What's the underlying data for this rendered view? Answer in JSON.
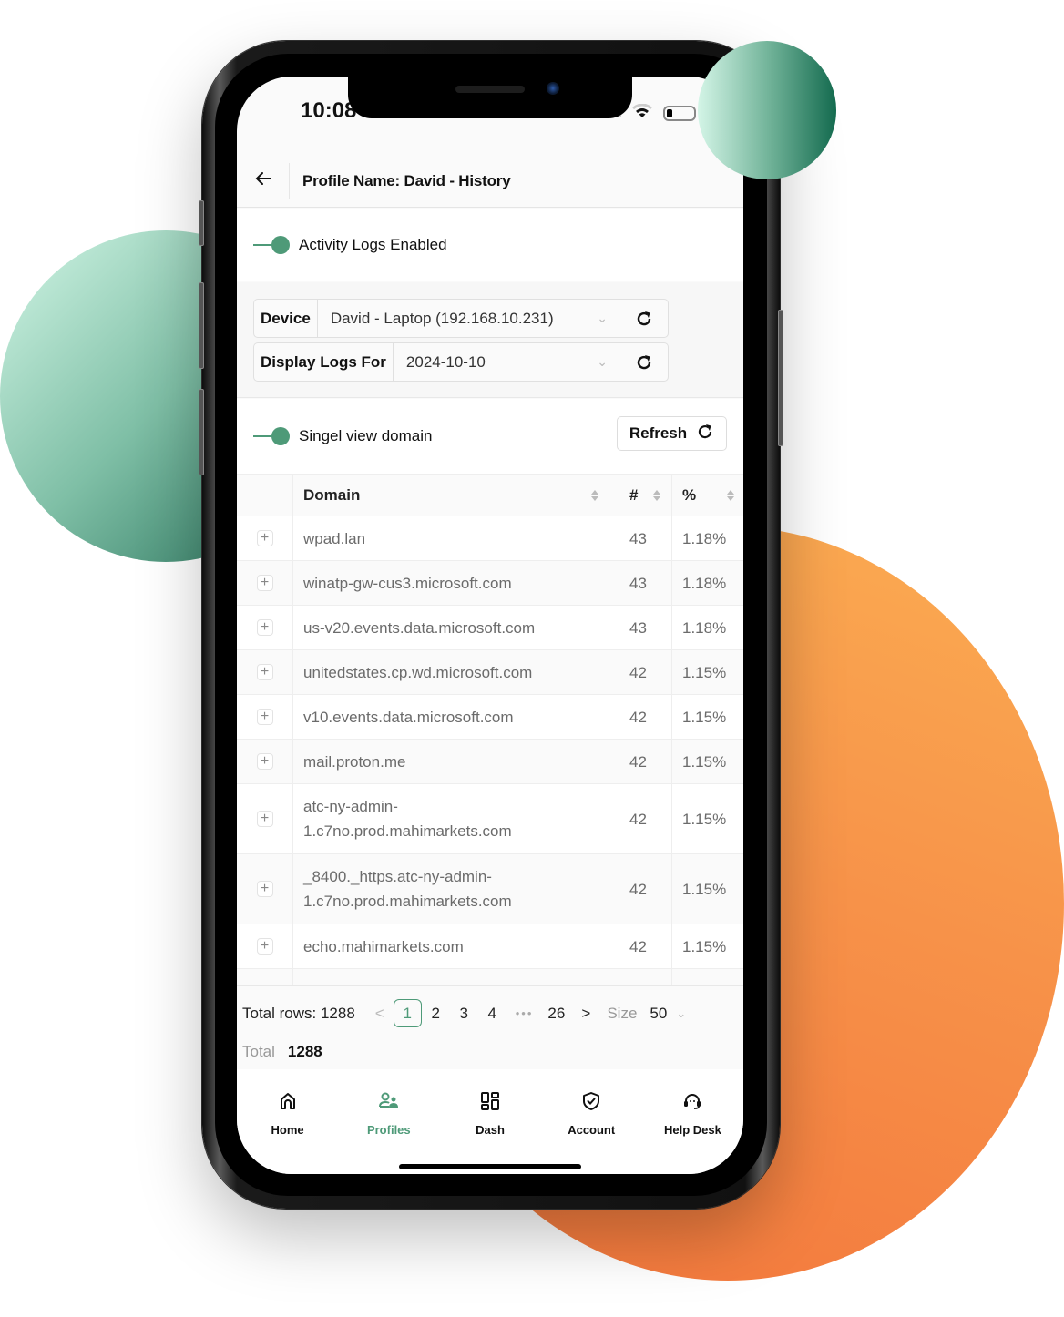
{
  "status_bar": {
    "time": "10:08"
  },
  "header": {
    "title": "Profile Name: David - History",
    "back_icon": "arrow-left-icon"
  },
  "activity_logs": {
    "label": "Activity Logs Enabled",
    "enabled": true
  },
  "filters": {
    "device": {
      "label": "Device",
      "value": "David - Laptop (192.168.10.231)"
    },
    "display_logs_for": {
      "label": "Display Logs For",
      "value": "2024-10-10"
    }
  },
  "single_view": {
    "label": "Singel view domain",
    "enabled": true
  },
  "refresh_button": {
    "label": "Refresh"
  },
  "table": {
    "columns": [
      "Domain",
      "#",
      "%"
    ],
    "rows": [
      {
        "domain": "wpad.lan",
        "count": "43",
        "percent": "1.18%"
      },
      {
        "domain": "winatp-gw-cus3.microsoft.com",
        "count": "43",
        "percent": "1.18%"
      },
      {
        "domain": "us-v20.events.data.microsoft.com",
        "count": "43",
        "percent": "1.18%"
      },
      {
        "domain": "unitedstates.cp.wd.microsoft.com",
        "count": "42",
        "percent": "1.15%"
      },
      {
        "domain": "v10.events.data.microsoft.com",
        "count": "42",
        "percent": "1.15%"
      },
      {
        "domain": "mail.proton.me",
        "count": "42",
        "percent": "1.15%"
      },
      {
        "domain": "atc-ny-admin-1.c7no.prod.mahimarkets.com",
        "count": "42",
        "percent": "1.15%"
      },
      {
        "domain": "_8400._https.atc-ny-admin-1.c7no.prod.mahimarkets.com",
        "count": "42",
        "percent": "1.15%"
      },
      {
        "domain": "echo.mahimarkets.com",
        "count": "42",
        "percent": "1.15%"
      }
    ]
  },
  "pagination": {
    "total_rows_text": "Total rows: 1288",
    "prev": "<",
    "pages": [
      "1",
      "2",
      "3",
      "4"
    ],
    "current_page": "1",
    "ellipsis": "•••",
    "last_page": "26",
    "next": ">",
    "size_label": "Size",
    "size_value": "50",
    "total_label": "Total",
    "total_value": "1288"
  },
  "bottom_nav": {
    "items": [
      {
        "label": "Home",
        "icon": "home-icon"
      },
      {
        "label": "Profiles",
        "icon": "profiles-icon",
        "active": true
      },
      {
        "label": "Dash",
        "icon": "dashboard-icon"
      },
      {
        "label": "Account",
        "icon": "shield-check-icon"
      },
      {
        "label": "Help Desk",
        "icon": "headset-icon"
      }
    ]
  },
  "colors": {
    "accent": "#4e9a78",
    "orange": "#f7914a",
    "green_dark": "#146b4f"
  }
}
